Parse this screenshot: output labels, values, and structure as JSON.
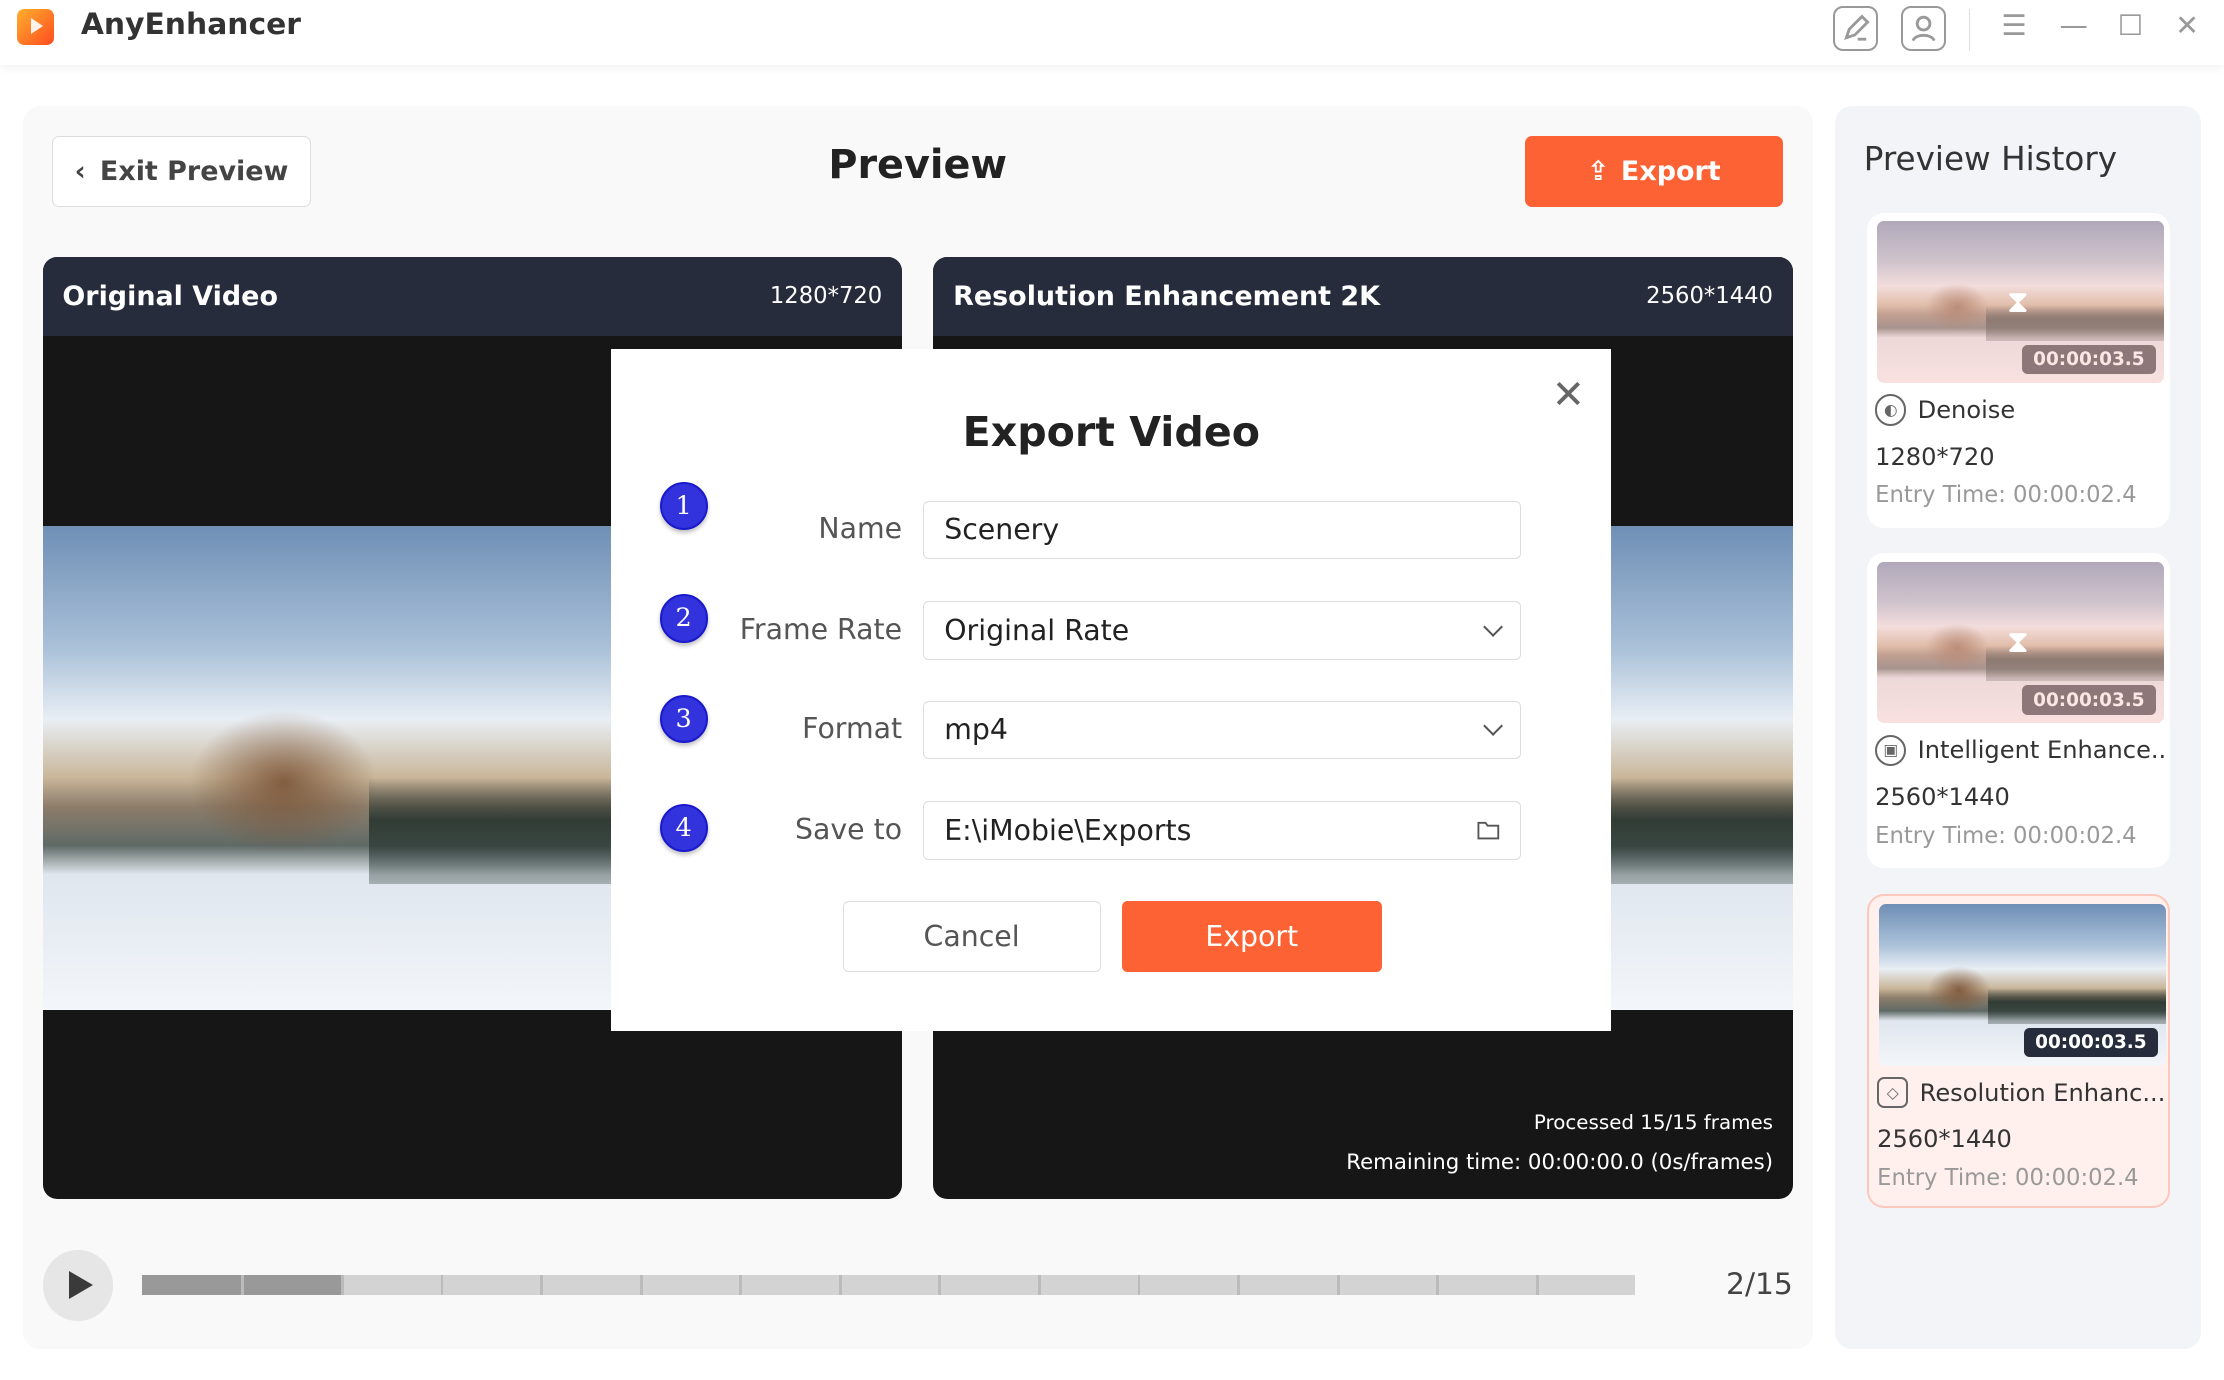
{
  "app": {
    "title": "AnyEnhancer"
  },
  "toolbar": {
    "icons": [
      "edit-icon",
      "user-icon",
      "menu-icon",
      "minimize-icon",
      "maximize-icon",
      "close-icon"
    ]
  },
  "header": {
    "exit_label": "Exit Preview",
    "title": "Preview",
    "export_label": "Export"
  },
  "panels": [
    {
      "title": "Original Video",
      "resolution": "1280*720"
    },
    {
      "title": "Resolution Enhancement 2K",
      "resolution": "2560*1440",
      "processed": "Processed 15/15 frames",
      "remaining": "Remaining time: 00:00:00.0 (0s/frames)"
    }
  ],
  "dialog": {
    "title": "Export Video",
    "fields": [
      {
        "step": "1",
        "label": "Name",
        "value": "Scenery"
      },
      {
        "step": "2",
        "label": "Frame Rate",
        "value": "Original Rate"
      },
      {
        "step": "3",
        "label": "Format",
        "value": "mp4"
      },
      {
        "step": "4",
        "label": "Save to",
        "value": "E:\\iMobie\\Exports"
      }
    ],
    "cancel_label": "Cancel",
    "export_label": "Export"
  },
  "playback": {
    "position": "2/15",
    "current_frame": 2,
    "total_frames": 15
  },
  "history": {
    "title": "Preview History",
    "items": [
      {
        "name": "Denoise",
        "icon": "denoise-icon",
        "resolution": "1280*720",
        "entry": "Entry Time: 00:00:02.4",
        "duration": "00:00:03.5",
        "processing": true,
        "selected": false
      },
      {
        "name": "Intelligent Enhance...",
        "icon": "robot-icon",
        "resolution": "2560*1440",
        "entry": "Entry Time: 00:00:02.4",
        "duration": "00:00:03.5",
        "processing": true,
        "selected": false
      },
      {
        "name": "Resolution Enhanc...",
        "icon": "diamond-icon",
        "resolution": "2560*1440",
        "entry": "Entry Time: 00:00:02.4",
        "duration": "00:00:03.5",
        "processing": false,
        "selected": true
      }
    ]
  },
  "colors": {
    "accent": "#fd6234",
    "header_dark": "#262c3b",
    "step_badge": "#3333dd"
  }
}
